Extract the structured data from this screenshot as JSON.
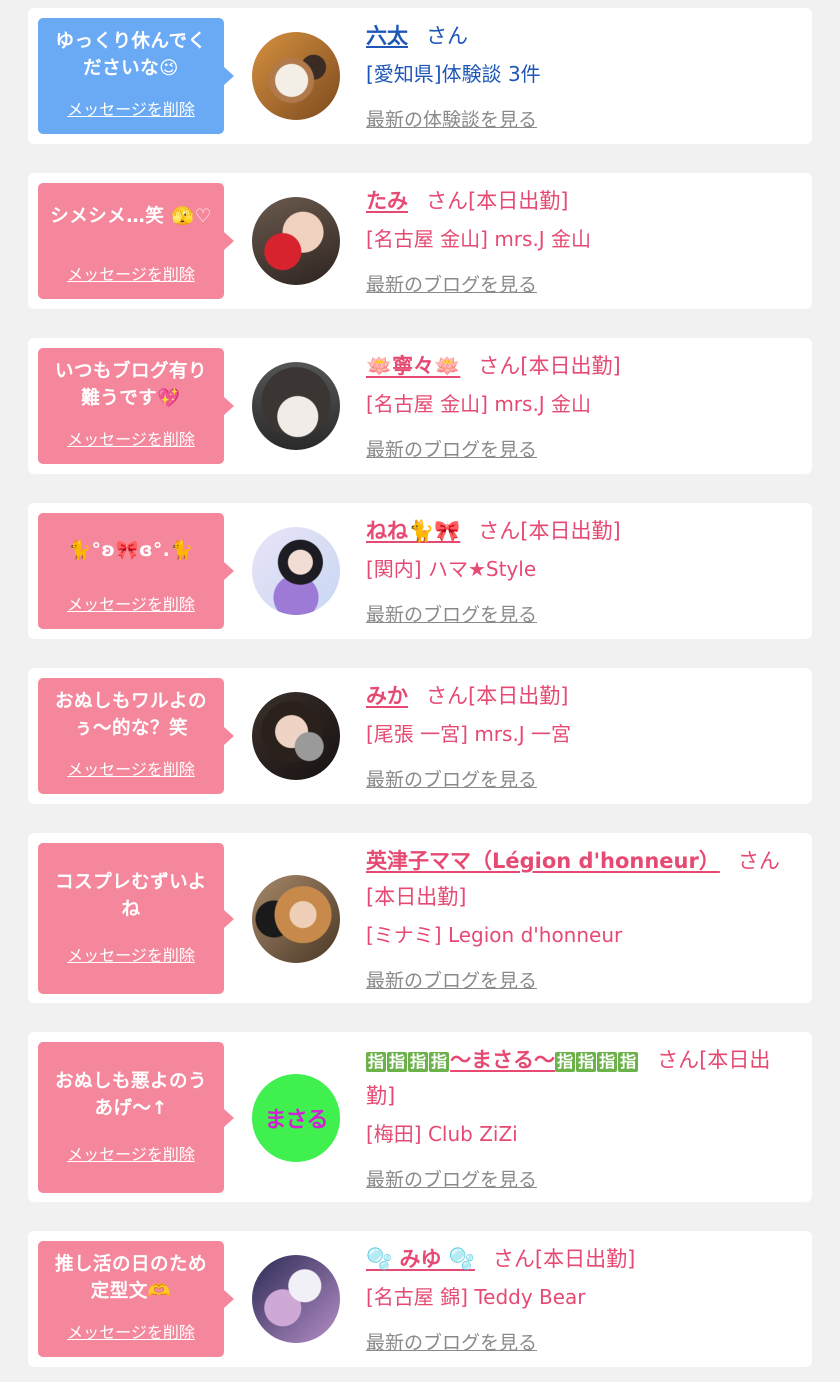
{
  "cards": [
    {
      "variant": "blue",
      "message": "ゆっくり休んでくださいな😉",
      "delete_label": "メッセージを削除",
      "name": "六太",
      "honorific": "さん",
      "shop": "[愛知県]体験談 3件",
      "link": "最新の体験談を見る",
      "avatar_icon": "food-photo-avatar"
    },
    {
      "variant": "pink",
      "message": "シメシメ…笑 🫣♡",
      "delete_label": "メッセージを削除",
      "name": "たみ",
      "honorific": "さん[本日出勤]",
      "shop": "[名古屋 金山] mrs.J 金山",
      "link": "最新のブログを見る",
      "avatar_icon": "strawberry-photo-avatar"
    },
    {
      "variant": "pink",
      "message": "いつもブログ有り難うです💖",
      "delete_label": "メッセージを削除",
      "name": "🪷寧々🪷",
      "honorific": "さん[本日出勤]",
      "shop": "[名古屋 金山] mrs.J 金山",
      "link": "最新のブログを見る",
      "avatar_icon": "portrait-photo-avatar"
    },
    {
      "variant": "pink",
      "message": "🐈°ʚ🎀ɞ°.🐈",
      "delete_label": "メッセージを削除",
      "name": "ねね🐈🎀",
      "honorific": "さん[本日出勤]",
      "shop": "[関内] ハマ★Style",
      "link": "最新のブログを見る",
      "avatar_icon": "cat-ears-photo-avatar"
    },
    {
      "variant": "pink",
      "message": "おぬしもワルよのぅ〜的な？笑",
      "delete_label": "メッセージを削除",
      "name": "みか",
      "honorific": "さん[本日出勤]",
      "shop": "[尾張 一宮] mrs.J 一宮",
      "link": "最新のブログを見る",
      "avatar_icon": "sticker-photo-avatar"
    },
    {
      "variant": "pink",
      "message": "コスプレむずいよね",
      "delete_label": "メッセージを削除",
      "name": "英津子ママ（Légion d'honneur）",
      "honorific": "さん[本日出勤]",
      "shop": "[ミナミ] Legion d'honneur",
      "link": "最新のブログを見る",
      "avatar_icon": "portrait-photo-avatar"
    },
    {
      "variant": "pink",
      "message": "おぬしも悪よのうあげ〜↑",
      "delete_label": "メッセージを削除",
      "name_badge": "指",
      "name": "〜まさる〜",
      "honorific": "さん[本日出勤]",
      "shop": "[梅田] Club ZiZi",
      "link": "最新のブログを見る",
      "avatar_text": "まさる",
      "avatar_icon": "text-logo-avatar"
    },
    {
      "variant": "pink",
      "message": "推し活の日のため定型文🫶",
      "delete_label": "メッセージを削除",
      "name": "🫧 みゆ 🫧",
      "honorific": "さん[本日出勤]",
      "shop": "[名古屋 錦] Teddy Bear",
      "link": "最新のブログを見る",
      "avatar_icon": "photo-avatar"
    }
  ]
}
